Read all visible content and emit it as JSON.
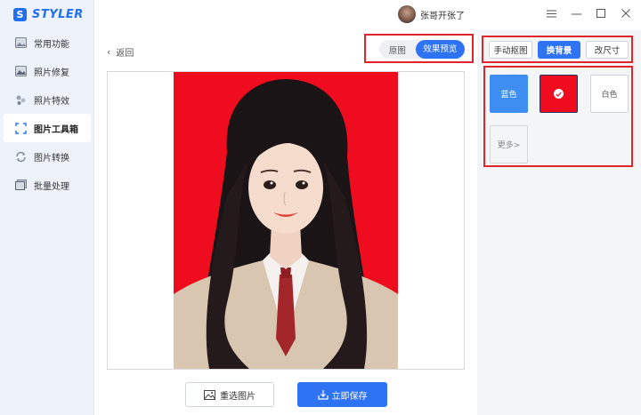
{
  "app": {
    "logo_letter": "S",
    "logo_text": "STYLER"
  },
  "sidebar": {
    "items": [
      {
        "label": "常用功能",
        "icon": "common-functions-icon"
      },
      {
        "label": "照片修复",
        "icon": "photo-repair-icon"
      },
      {
        "label": "照片特效",
        "icon": "photo-effects-icon"
      },
      {
        "label": "图片工具箱",
        "icon": "image-toolbox-icon",
        "active": true
      },
      {
        "label": "图片转换",
        "icon": "image-convert-icon"
      },
      {
        "label": "批量处理",
        "icon": "batch-process-icon"
      }
    ]
  },
  "header": {
    "username": "张哥开张了",
    "controls": [
      "menu-icon",
      "minimize-icon",
      "maximize-icon",
      "close-icon"
    ]
  },
  "main": {
    "back_label": "返回",
    "view_toggle": {
      "original": "原图",
      "preview": "效果预览",
      "selected": "效果预览"
    },
    "reselect_label": "重选图片",
    "save_label": "立即保存"
  },
  "right_panel": {
    "tabs": [
      {
        "label": "手动抠图"
      },
      {
        "label": "换背景",
        "active": true
      },
      {
        "label": "改尺寸"
      }
    ],
    "colors": {
      "blue": "蓝色",
      "red_selected": true,
      "white": "白色",
      "more": "更多>"
    }
  },
  "theme": {
    "accent": "#2f73f5",
    "photo_background": "#ef0c1e",
    "highlight_border": "#e0262b"
  }
}
